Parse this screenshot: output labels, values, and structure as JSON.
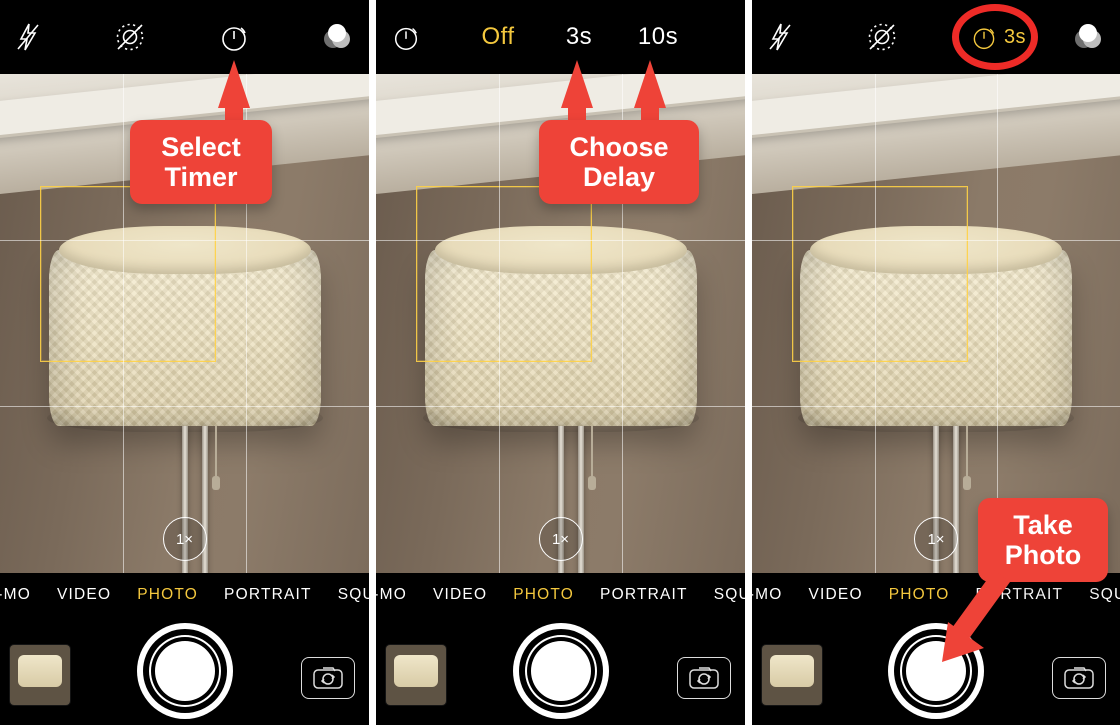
{
  "zoom_label": "1×",
  "modes": [
    "SLO-MO",
    "VIDEO",
    "PHOTO",
    "PORTRAIT",
    "SQUARE"
  ],
  "selected_mode_index": 2,
  "timer_options": {
    "off": "Off",
    "three": "3s",
    "ten": "10s"
  },
  "timer_selected_label": "3s",
  "callouts": {
    "select_timer_l1": "Select",
    "select_timer_l2": "Timer",
    "choose_delay_l1": "Choose",
    "choose_delay_l2": "Delay",
    "take_photo_l1": "Take",
    "take_photo_l2": "Photo"
  },
  "icons": {
    "flash": "flash-off-icon",
    "live": "live-photo-off-icon",
    "timer": "timer-icon",
    "filters": "filters-icon",
    "switch": "camera-switch-icon"
  },
  "colors": {
    "accent": "#f4c83e",
    "callout": "#ee4338",
    "ring": "#ee2b27"
  }
}
